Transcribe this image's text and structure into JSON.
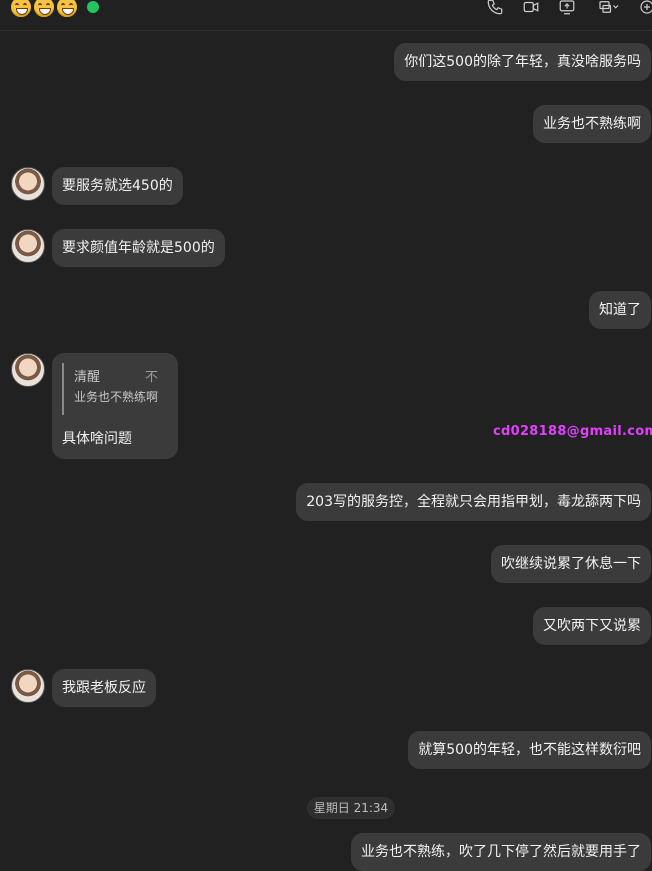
{
  "header": {
    "emojis": [
      "grinning-face",
      "grinning-face",
      "grinning-face"
    ],
    "status_color": "#22c55e",
    "icons": [
      "phone-icon",
      "video-icon",
      "screen-share-icon",
      "layout-switch-icon",
      "add-member-icon"
    ]
  },
  "messages": [
    {
      "side": "right",
      "text": "你们这500的除了年轻，真没啥服务吗"
    },
    {
      "side": "right",
      "text": "业务也不熟练啊"
    },
    {
      "side": "left",
      "text": "要服务就选450的"
    },
    {
      "side": "left",
      "text": "要求颜值年龄就是500的"
    },
    {
      "side": "right",
      "text": "知道了"
    },
    {
      "side": "left",
      "quote": {
        "name": "清醒",
        "flag": "不",
        "text": "业务也不熟练啊"
      },
      "text": "具体啥问题"
    },
    {
      "side": "right",
      "text": "203写的服务控，全程就只会用指甲划，毒龙舔两下吗"
    },
    {
      "side": "right",
      "text": "吹继续说累了休息一下"
    },
    {
      "side": "right",
      "text": "又吹两下又说累"
    },
    {
      "side": "left",
      "text": "我跟老板反应"
    },
    {
      "side": "right",
      "text": "就算500的年轻，也不能这样数衍吧"
    },
    {
      "side": "right",
      "text": "业务也不熟练，吹了几下停了然后就要用手了"
    }
  ],
  "date_divider": "星期日 21:34",
  "watermark": "cd028188@gmail.com",
  "colors": {
    "background": "#212121",
    "bubble": "#3b3b3b",
    "watermark": "#e040fb"
  }
}
